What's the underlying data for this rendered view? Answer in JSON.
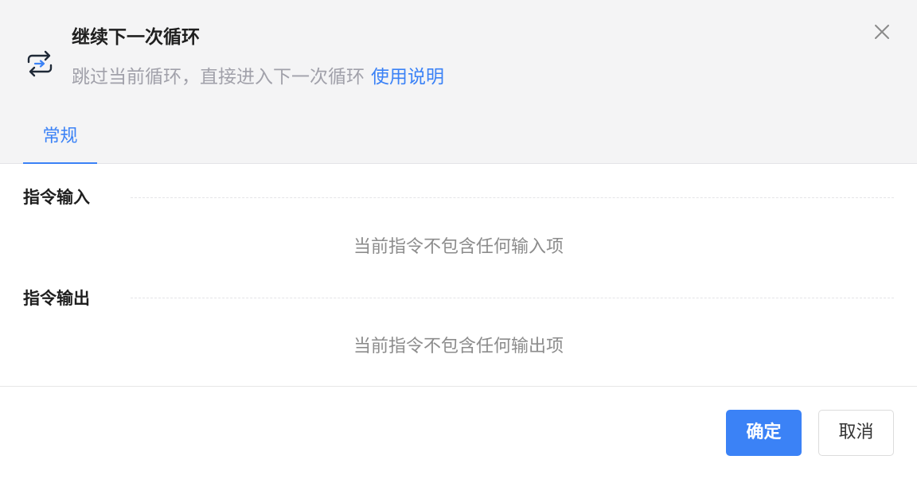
{
  "header": {
    "icon": "loop-arrows-icon",
    "title": "继续下一次循环",
    "description": "跳过当前循环，直接进入下一次循环",
    "help_link": "使用说明",
    "close_icon": "close-icon"
  },
  "tabs": [
    {
      "label": "常规",
      "active": true
    }
  ],
  "sections": {
    "input": {
      "title": "指令输入",
      "empty_text": "当前指令不包含任何输入项"
    },
    "output": {
      "title": "指令输出",
      "empty_text": "当前指令不包含任何输出项"
    }
  },
  "footer": {
    "confirm_label": "确定",
    "cancel_label": "取消"
  },
  "colors": {
    "accent": "#3b82f6",
    "header_bg": "#f4f4f5",
    "muted_text": "#a1a1aa"
  }
}
